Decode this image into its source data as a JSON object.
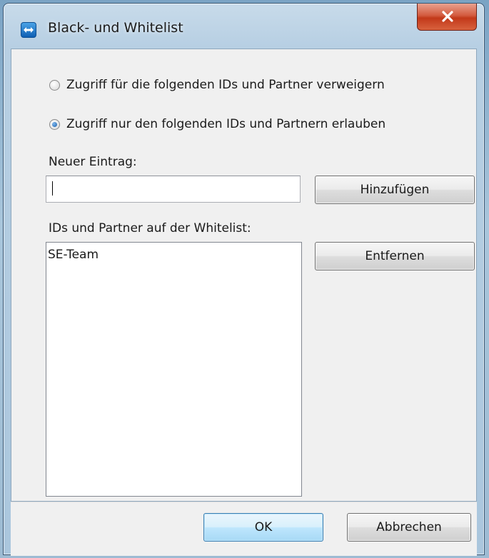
{
  "window": {
    "title": "Black- und Whitelist"
  },
  "options": {
    "deny_label": "Zugriff für die folgenden IDs und Partner verweigern",
    "deny_selected": false,
    "allow_label": "Zugriff nur den folgenden IDs und Partnern erlauben",
    "allow_selected": true
  },
  "new_entry": {
    "label": "Neuer Eintrag:",
    "value": "",
    "add_button": "Hinzufügen"
  },
  "whitelist": {
    "label": "IDs und Partner auf der Whitelist:",
    "items": [
      "SE-Team"
    ],
    "remove_button": "Entfernen"
  },
  "footer": {
    "ok_button": "OK",
    "cancel_button": "Abbrechen"
  },
  "icons": {
    "app": "teamviewer-icon",
    "close": "close-icon"
  },
  "colors": {
    "close_button": "#c2391a",
    "ok_border": "#3c7fb1",
    "window_frame": "#b7cfe3"
  }
}
